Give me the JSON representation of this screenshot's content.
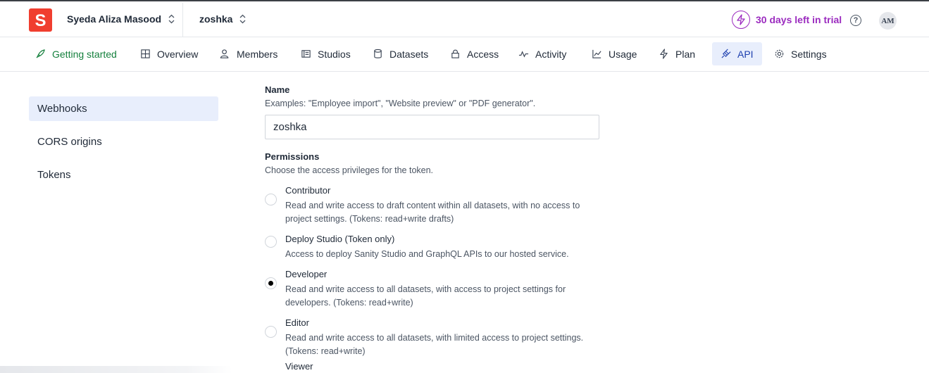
{
  "header": {
    "logo_letter": "S",
    "organization": "Syeda Aliza Masood",
    "project": "zoshka",
    "trial_text": "30 days left in trial",
    "help_glyph": "?",
    "avatar_initials": "AM"
  },
  "tabs": [
    {
      "label": "Getting started",
      "icon": "rocket-icon"
    },
    {
      "label": "Overview",
      "icon": "grid-icon"
    },
    {
      "label": "Members",
      "icon": "users-icon"
    },
    {
      "label": "Studios",
      "icon": "studio-icon"
    },
    {
      "label": "Datasets",
      "icon": "database-icon"
    },
    {
      "label": "Access",
      "icon": "lock-icon"
    },
    {
      "label": "Activity",
      "icon": "activity-icon"
    },
    {
      "label": "Usage",
      "icon": "chart-icon"
    },
    {
      "label": "Plan",
      "icon": "bolt-icon"
    },
    {
      "label": "API",
      "icon": "plug-icon",
      "active": true
    },
    {
      "label": "Settings",
      "icon": "gear-icon"
    }
  ],
  "sidebar": {
    "items": [
      {
        "label": "Webhooks",
        "active": true
      },
      {
        "label": "CORS origins"
      },
      {
        "label": "Tokens"
      }
    ]
  },
  "form": {
    "name_label": "Name",
    "name_help": "Examples: \"Employee import\", \"Website preview\" or \"PDF generator\".",
    "name_value": "zoshka",
    "permissions_label": "Permissions",
    "permissions_help": "Choose the access privileges for the token.",
    "options": [
      {
        "title": "Contributor",
        "desc": "Read and write access to draft content within all datasets, with no access to project settings. (Tokens: read+write drafts)",
        "checked": false
      },
      {
        "title": "Deploy Studio (Token only)",
        "desc": "Access to deploy Sanity Studio and GraphQL APIs to our hosted service.",
        "checked": false
      },
      {
        "title": "Developer",
        "desc": "Read and write access to all datasets, with access to project settings for developers. (Tokens: read+write)",
        "checked": true
      },
      {
        "title": "Editor",
        "desc": "Read and write access to all datasets, with limited access to project settings. (Tokens: read+write)",
        "checked": false
      },
      {
        "title": "Viewer",
        "desc": "",
        "checked": false
      }
    ]
  },
  "colors": {
    "brand_red": "#f03e2f",
    "trial_purple": "#9b2bbf",
    "active_tab_bg": "#e8eefc",
    "active_tab_text": "#1e40af",
    "getting_started_green": "#15803d"
  }
}
